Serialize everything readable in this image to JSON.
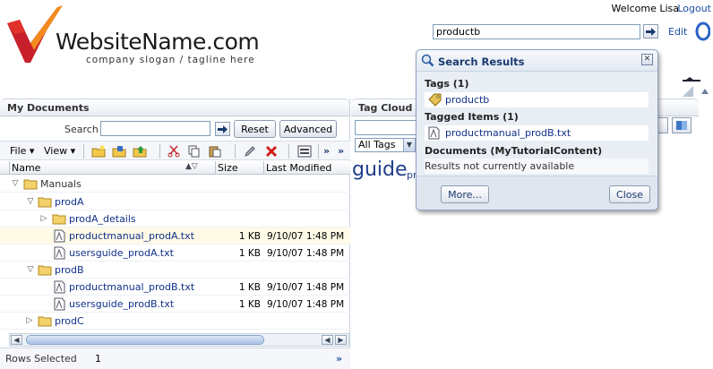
{
  "header": {
    "brand_name": "WebsiteName.com",
    "slogan": "company slogan / tagline here",
    "welcome_text": "Welcome Lisa",
    "logout_label": "Logout",
    "search_value": "productb",
    "edit_label": "Edit"
  },
  "documents": {
    "title": "My Documents",
    "search_label": "Search",
    "search_value": "",
    "reset_label": "Reset",
    "advanced_label": "Advanced",
    "toolbar": {
      "file_menu": "File",
      "view_menu": "View"
    },
    "columns": {
      "name": "Name",
      "size": "Size",
      "modified": "Last Modified"
    },
    "rows": [
      {
        "name": "Manuals",
        "type": "folder",
        "size": "",
        "modified": ""
      },
      {
        "name": "prodA",
        "type": "folder",
        "size": "",
        "modified": ""
      },
      {
        "name": "prodA_details",
        "type": "folder",
        "size": "",
        "modified": ""
      },
      {
        "name": "productmanual_prodA.txt",
        "type": "file",
        "size": "1 KB",
        "modified": "9/10/07 1:48 PM"
      },
      {
        "name": "usersguide_prodA.txt",
        "type": "file",
        "size": "1 KB",
        "modified": "9/10/07 1:48 PM"
      },
      {
        "name": "prodB",
        "type": "folder",
        "size": "",
        "modified": ""
      },
      {
        "name": "productmanual_prodB.txt",
        "type": "file",
        "size": "1 KB",
        "modified": "9/10/07 1:48 PM"
      },
      {
        "name": "usersguide_prodB.txt",
        "type": "file",
        "size": "1 KB",
        "modified": "9/10/07 1:48 PM"
      },
      {
        "name": "prodC",
        "type": "folder",
        "size": "",
        "modified": ""
      }
    ],
    "status": {
      "rows_selected_label": "Rows Selected",
      "rows_selected_count": "1"
    }
  },
  "tag_cloud": {
    "title": "Tag Cloud",
    "filter_value": "All Tags",
    "tag_large": "guide",
    "tag_small": "pr"
  },
  "search_results": {
    "title": "Search Results",
    "tags_heading": "Tags (1)",
    "tag_item": "productb",
    "tagged_heading": "Tagged Items (1)",
    "tagged_item": "productmanual_prodB.txt",
    "documents_heading": "Documents (MyTutorialContent)",
    "documents_message": "Results not currently available",
    "more_label": "More...",
    "close_label": "Close"
  },
  "colors": {
    "link": "#1f4fa0",
    "selected_row": "#fffbe6",
    "logo_red": "#c8202a",
    "logo_orange": "#f28a1f"
  }
}
